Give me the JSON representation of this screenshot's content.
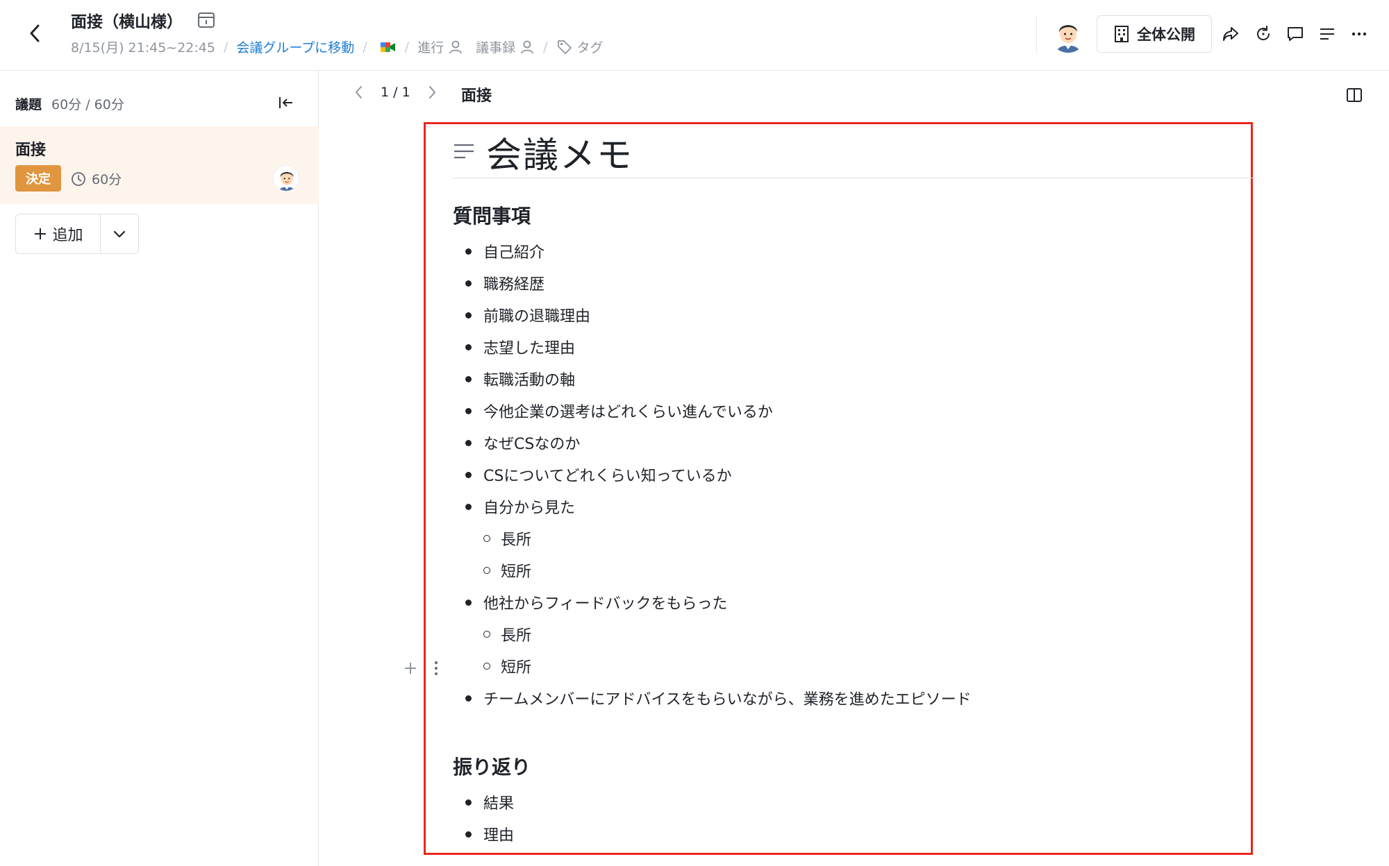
{
  "header": {
    "title": "面接（横山様）",
    "datetime": "8/15(月) 21:45~22:45",
    "group_link": "会議グループに移動",
    "progress_label": "進行",
    "minutes_label": "議事録",
    "tag_label": "タグ",
    "public_button": "全体公開"
  },
  "sidebar": {
    "heading": "議題",
    "time_count": "60分 / 60分",
    "agenda": [
      {
        "title": "面接",
        "badge": "決定",
        "duration": "60分"
      }
    ],
    "add_label": "追加"
  },
  "main": {
    "pager": "1 / 1",
    "page_title": "面接",
    "doc_title": "会議メモ",
    "sections": [
      {
        "heading": "質問事項",
        "items": [
          "自己紹介",
          "職務経歴",
          "前職の退職理由",
          "志望した理由",
          "転職活動の軸",
          "今他企業の選考はどれくらい進んでいるか",
          "なぜCSなのか",
          "CSについてどれくらい知っているか",
          "自分から見た",
          "長所",
          "短所",
          "他社からフィードバックをもらった",
          "長所",
          "短所",
          "チームメンバーにアドバイスをもらいながら、業務を進めたエピソード"
        ]
      },
      {
        "heading": "振り返り",
        "items": [
          "結果",
          "理由"
        ]
      }
    ]
  },
  "colors": {
    "accent_link": "#1f7dd6",
    "badge": "#e0953f",
    "selection_border": "#e8271d",
    "agenda_highlight": "#fdf4ec"
  }
}
